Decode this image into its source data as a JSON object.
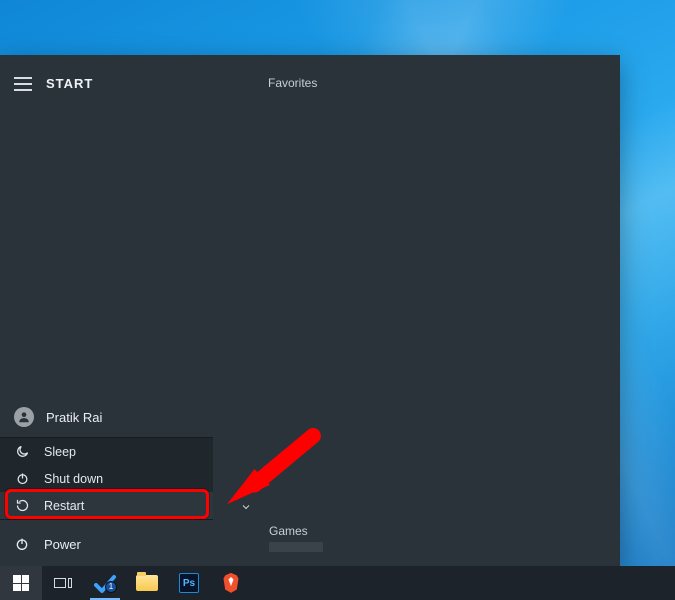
{
  "start": {
    "title": "START",
    "favorites_label": "Favorites",
    "games_label": "Games",
    "user_name": "Pratik Rai",
    "power_label": "Power",
    "power_menu": {
      "sleep": "Sleep",
      "shutdown": "Shut down",
      "restart": "Restart"
    }
  },
  "taskbar": {
    "todo_badge": "1",
    "ps_label": "Ps"
  },
  "annotation": {
    "highlighted_item": "restart"
  }
}
